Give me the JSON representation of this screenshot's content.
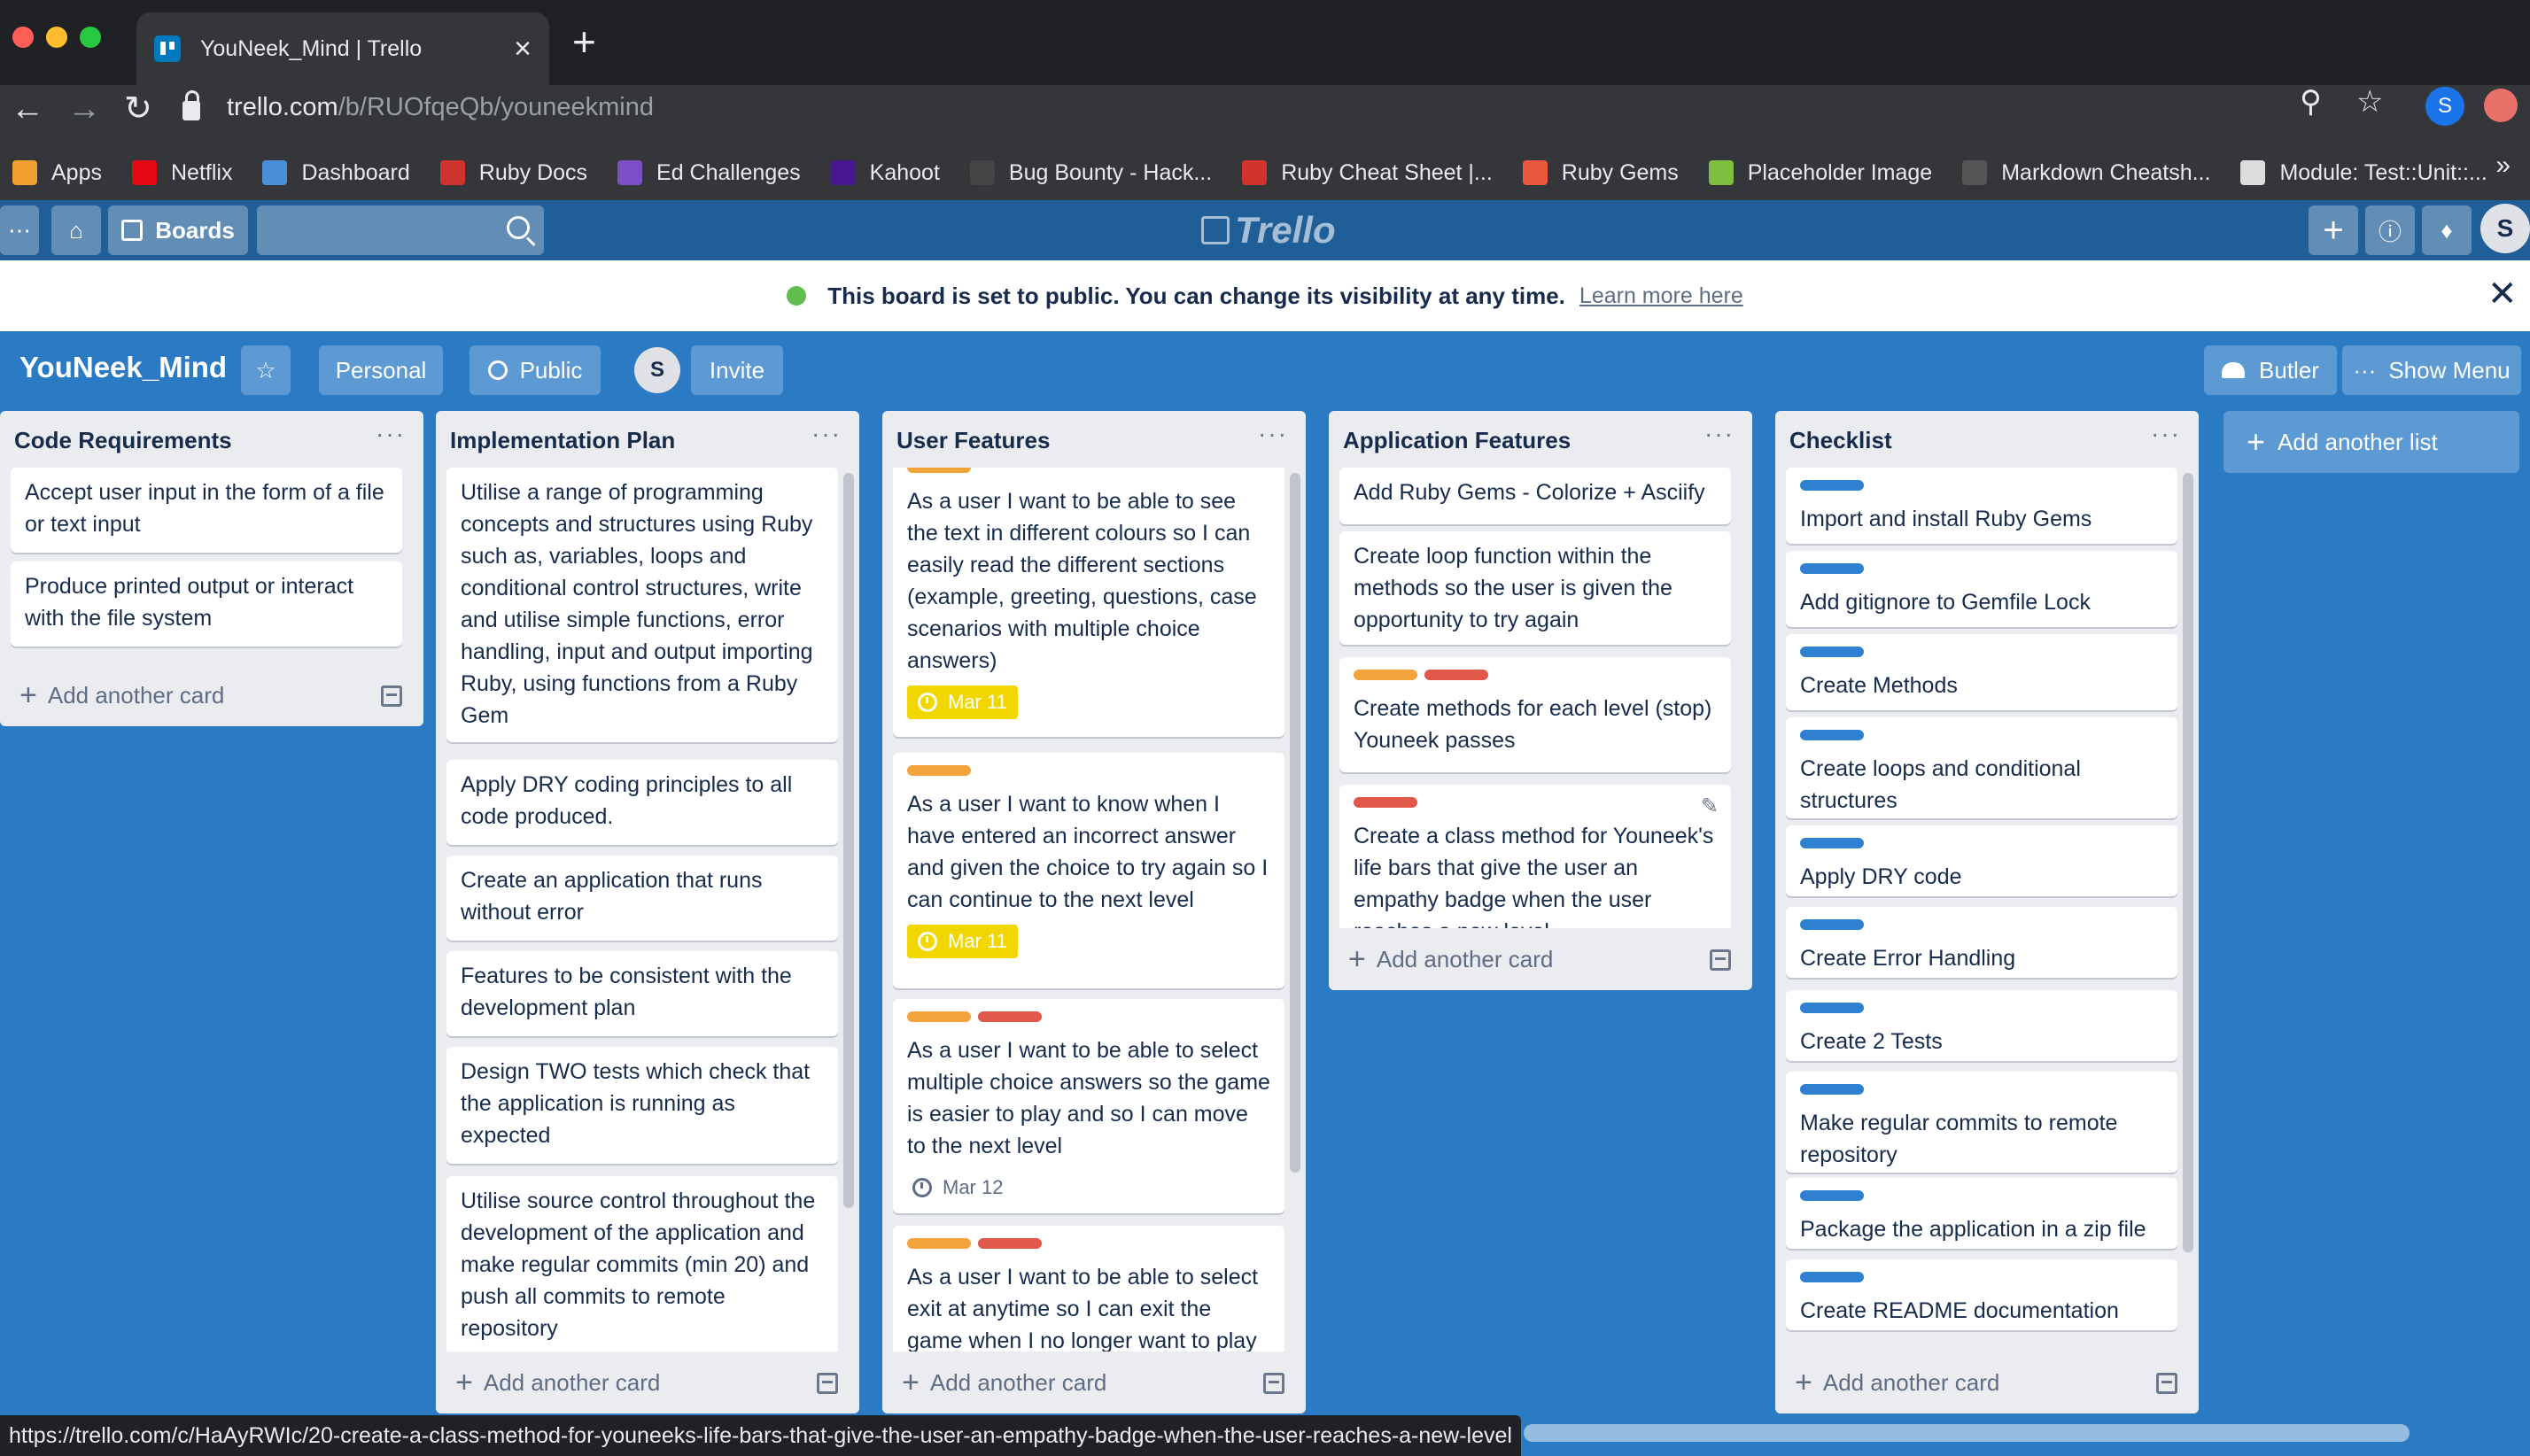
{
  "browser": {
    "tab_title": "YouNeek_Mind | Trello",
    "tab_close": "×",
    "new_tab": "+",
    "url_host": "trello.com",
    "url_path": "/b/RUOfqeQb/youneekmind",
    "profile_initial": "S",
    "bookmarks": [
      {
        "label": "Apps",
        "icon": "apps-grid-icon",
        "color": "#f0a030"
      },
      {
        "label": "Netflix",
        "icon": "netflix-icon",
        "color": "#e50914"
      },
      {
        "label": "Dashboard",
        "icon": "dashboard-icon",
        "color": "#4b8fd6"
      },
      {
        "label": "Ruby Docs",
        "icon": "ruby-icon",
        "color": "#cc342d"
      },
      {
        "label": "Ed Challenges",
        "icon": "ed-icon",
        "color": "#7b4fc8"
      },
      {
        "label": "Kahoot",
        "icon": "kahoot-icon",
        "color": "#46178f"
      },
      {
        "label": "Bug Bounty - Hack...",
        "icon": "hackerone-icon",
        "color": "#444444"
      },
      {
        "label": "Ruby Cheat Sheet |...",
        "icon": "cheatsheet-icon",
        "color": "#d0342c"
      },
      {
        "label": "Ruby Gems",
        "icon": "rubygems-icon",
        "color": "#e9573f"
      },
      {
        "label": "Placeholder Image",
        "icon": "placeholder-icon",
        "color": "#7fbf3f"
      },
      {
        "label": "Markdown Cheatsh...",
        "icon": "github-icon",
        "color": "#555555"
      },
      {
        "label": "Module: Test::Unit::...",
        "icon": "testunit-icon",
        "color": "#dddddd"
      }
    ],
    "bookmarks_more": "»",
    "status_url": "https://trello.com/c/HaAyRWIc/20-create-a-class-method-for-youneeks-life-bars-that-give-the-user-an-empathy-badge-when-the-user-reaches-a-new-level"
  },
  "header": {
    "boards_label": "Boards",
    "logo_text": "Trello",
    "avatar_initial": "S"
  },
  "banner": {
    "message": "This board is set to public. You can change its visibility at any time.",
    "link": "Learn more here"
  },
  "board": {
    "title": "YouNeek_Mind",
    "team_label": "Personal",
    "visibility_label": "Public",
    "member_initial": "S",
    "invite_label": "Invite",
    "butler_label": "Butler",
    "show_menu_label": "Show Menu",
    "add_list_label": "Add another list"
  },
  "colors": {
    "orange": "#f2a33a",
    "red": "#e0584a",
    "blue": "#2f80d1",
    "due_yellow": "#f2d600",
    "board_bg": "#2b7ac4"
  },
  "add_card_label": "Add another card",
  "lists": [
    {
      "title": "Code Requirements",
      "cards": [
        {
          "text": "Accept user input in the form of a file or text input"
        },
        {
          "text": "Produce printed output or interact with the file system"
        }
      ]
    },
    {
      "title": "Implementation Plan",
      "cards": [
        {
          "text": "Utilise a range of programming concepts and structures using Ruby such as, variables, loops and conditional control structures, write and utilise simple functions, error handling, input and output importing Ruby, using functions from a Ruby Gem"
        },
        {
          "text": "Apply DRY coding principles to all code produced."
        },
        {
          "text": "Create an application that runs without error"
        },
        {
          "text": "Features to be consistent with the development plan"
        },
        {
          "text": "Design TWO tests which check that the application is running as expected"
        },
        {
          "text": "Utilise source control throughout the development of the application and make regular commits (min 20) and push all commits to remote repository"
        }
      ]
    },
    {
      "title": "User Features",
      "cards": [
        {
          "text": "As a user I want to be able to see the text in different colours so I can easily read the different sections (example, greeting, questions, case scenarios with multiple choice answers)",
          "due": "Mar 11",
          "labels": [
            "orange"
          ]
        },
        {
          "text": "As a user I want to know when I have entered an incorrect answer and given the choice to try again so I can continue to the next level",
          "due": "Mar 11",
          "labels": [
            "orange"
          ]
        },
        {
          "text": "As a user I want to be able to select multiple choice answers so the game is easier to play and so I can move to the next level",
          "date": "Mar 12",
          "labels": [
            "orange",
            "red"
          ]
        },
        {
          "text": "As a user I want to be able to select exit at anytime so I can exit the game when I no longer want to play",
          "labels": [
            "orange",
            "red"
          ]
        }
      ]
    },
    {
      "title": "Application Features",
      "cards": [
        {
          "text": "Add Ruby Gems - Colorize + Asciify"
        },
        {
          "text": "Create loop function within the methods so the user is given the opportunity to try again"
        },
        {
          "text": "Create methods for each level (stop) Youneek passes",
          "labels": [
            "orange",
            "red"
          ]
        },
        {
          "text": "Create a class method for Youneek's life bars that give the user an empathy badge when the user reaches a new level",
          "labels": [
            "red"
          ]
        }
      ]
    },
    {
      "title": "Checklist",
      "cards": [
        {
          "text": "Import and install Ruby Gems"
        },
        {
          "text": "Add gitignore to Gemfile Lock"
        },
        {
          "text": "Create Methods"
        },
        {
          "text": "Create loops and conditional structures"
        },
        {
          "text": "Apply DRY code"
        },
        {
          "text": "Create Error Handling"
        },
        {
          "text": "Create 2 Tests"
        },
        {
          "text": "Make regular commits to remote repository"
        },
        {
          "text": "Package the application in a zip file"
        },
        {
          "text": "Create README documentation"
        }
      ]
    }
  ]
}
